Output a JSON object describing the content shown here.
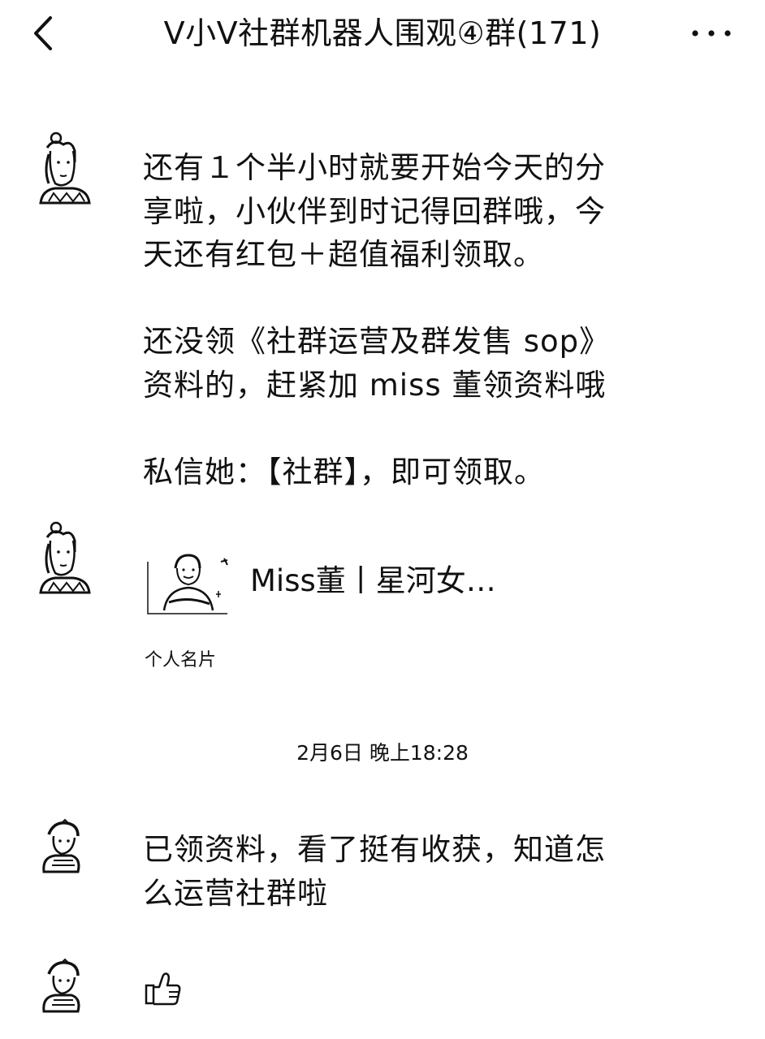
{
  "header": {
    "back_icon": "chevron-left-icon",
    "title": "V小V社群机器人围观④群(171)",
    "more_icon": "more-dots-icon"
  },
  "messages": [
    {
      "text": "还有１个半小时就要开始今天的分\n享啦，小伙伴到时记得回群哦，今\n天还有红包＋超值福利领取。\n\n还没领《社群运营及群发售 sop》\n资料的，赶紧加 miss 董领资料哦\n\n私信她：【社群】，即可领取。"
    },
    {
      "card": {
        "name": "Miss董丨星河女…",
        "type_label": "个人名片"
      }
    },
    {
      "timestamp": "2月6日 晚上18:28"
    },
    {
      "text": "已领资料，看了挺有收获，知道怎\n么运营社群啦"
    },
    {
      "emoji": "thumbs-up-icon"
    }
  ]
}
